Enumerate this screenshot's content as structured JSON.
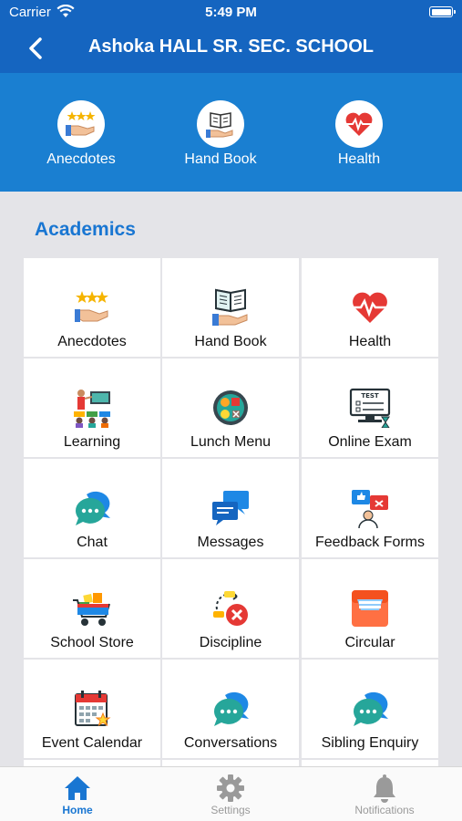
{
  "status_bar": {
    "carrier": "Carrier",
    "time": "5:49 PM"
  },
  "header": {
    "title": "Ashoka HALL SR. SEC. SCHOOL"
  },
  "quick_links": [
    {
      "label": "Anecdotes",
      "icon": "anecdotes-icon"
    },
    {
      "label": "Hand Book",
      "icon": "handbook-icon"
    },
    {
      "label": "Health",
      "icon": "health-icon"
    }
  ],
  "section": {
    "title": "Academics"
  },
  "tiles": [
    {
      "label": "Anecdotes",
      "icon": "anecdotes-icon"
    },
    {
      "label": "Hand Book",
      "icon": "handbook-icon"
    },
    {
      "label": "Health",
      "icon": "health-icon"
    },
    {
      "label": "Learning",
      "icon": "learning-icon"
    },
    {
      "label": "Lunch Menu",
      "icon": "lunch-menu-icon"
    },
    {
      "label": "Online Exam",
      "icon": "online-exam-icon"
    },
    {
      "label": "Chat",
      "icon": "chat-icon"
    },
    {
      "label": "Messages",
      "icon": "messages-icon"
    },
    {
      "label": "Feedback Forms",
      "icon": "feedback-forms-icon"
    },
    {
      "label": "School Store",
      "icon": "school-store-icon"
    },
    {
      "label": "Discipline",
      "icon": "discipline-icon"
    },
    {
      "label": "Circular",
      "icon": "circular-icon"
    },
    {
      "label": "Event Calendar",
      "icon": "event-calendar-icon"
    },
    {
      "label": "Conversations",
      "icon": "conversations-icon"
    },
    {
      "label": "Sibling Enquiry",
      "icon": "sibling-enquiry-icon"
    }
  ],
  "tab_bar": {
    "tabs": [
      {
        "label": "Home",
        "icon": "home-icon",
        "active": true
      },
      {
        "label": "Settings",
        "icon": "settings-icon",
        "active": false
      },
      {
        "label": "Notifications",
        "icon": "bell-icon",
        "active": false
      }
    ]
  },
  "colors": {
    "primary": "#1565c0",
    "banner": "#1a7fd1",
    "accent": "#1976d2",
    "background": "#e4e4e8"
  }
}
